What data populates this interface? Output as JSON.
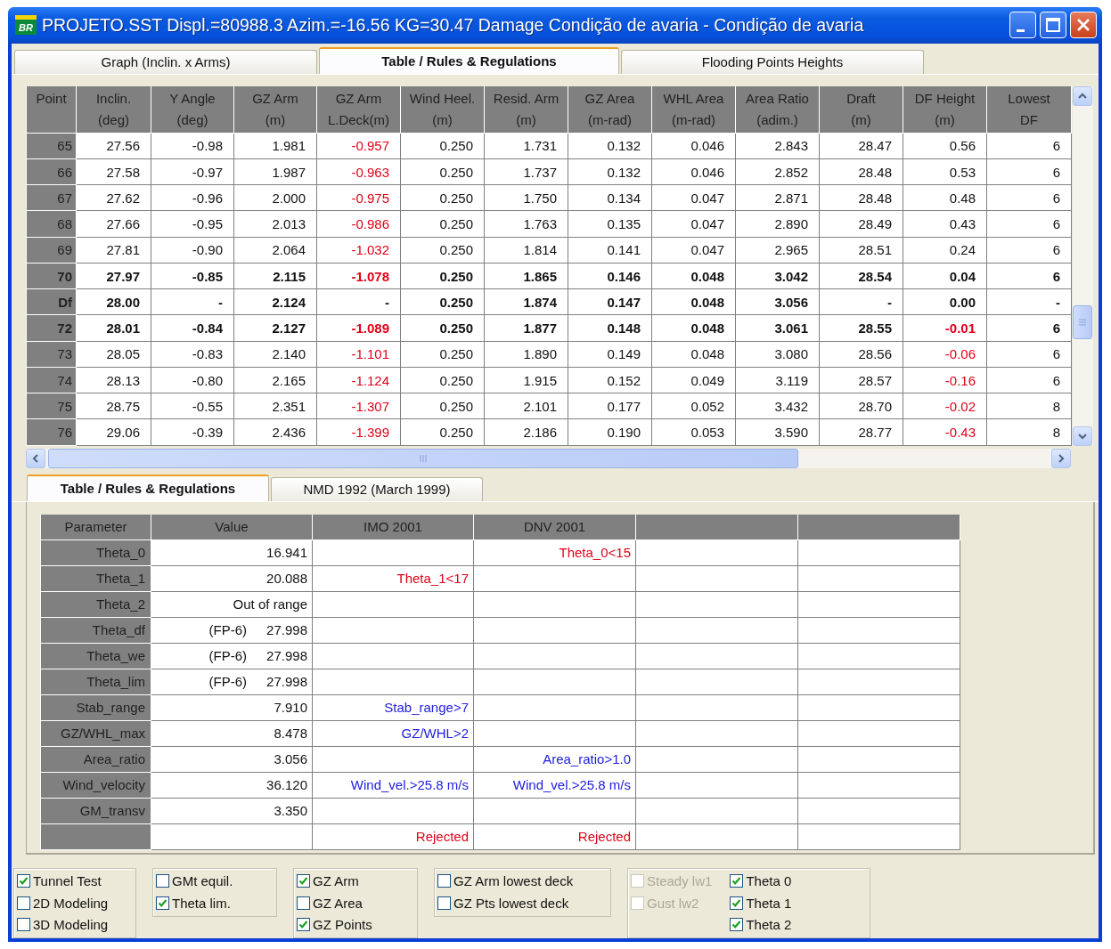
{
  "window": {
    "icon_text": "BR",
    "title": "PROJETO.SST Displ.=80988.3 Azim.=-16.56 KG=30.47 Damage Condição de avaria - Condição de avaria"
  },
  "tabs": [
    {
      "label": "Graph (Inclin. x Arms)",
      "selected": false
    },
    {
      "label": "Table / Rules & Regulations",
      "selected": true
    },
    {
      "label": "Flooding Points Heights",
      "selected": false
    }
  ],
  "grid": {
    "columns": [
      "Point",
      "Inclin.\n(deg)",
      "Y Angle\n(deg)",
      "GZ Arm\n(m)",
      "GZ Arm\nL.Deck(m)",
      "Wind Heel.\n(m)",
      "Resid. Arm\n(m)",
      "GZ Area\n(m-rad)",
      "WHL Area\n(m-rad)",
      "Area Ratio\n(adim.)",
      "Draft\n(m)",
      "DF Height\n(m)",
      "Lowest\nDF"
    ],
    "rows": [
      {
        "bold": false,
        "cells": [
          {
            "text": "65",
            "alarm": false
          },
          {
            "text": "27.56",
            "alarm": false
          },
          {
            "text": "-0.98",
            "alarm": false
          },
          {
            "text": "1.981",
            "alarm": false
          },
          {
            "text": "-0.957",
            "alarm": true
          },
          {
            "text": "0.250",
            "alarm": false
          },
          {
            "text": "1.731",
            "alarm": false
          },
          {
            "text": "0.132",
            "alarm": false
          },
          {
            "text": "0.046",
            "alarm": false
          },
          {
            "text": "2.843",
            "alarm": false
          },
          {
            "text": "28.47",
            "alarm": false
          },
          {
            "text": "0.56",
            "alarm": false
          },
          {
            "text": "6",
            "alarm": false
          }
        ]
      },
      {
        "bold": false,
        "cells": [
          {
            "text": "66",
            "alarm": false
          },
          {
            "text": "27.58",
            "alarm": false
          },
          {
            "text": "-0.97",
            "alarm": false
          },
          {
            "text": "1.987",
            "alarm": false
          },
          {
            "text": "-0.963",
            "alarm": true
          },
          {
            "text": "0.250",
            "alarm": false
          },
          {
            "text": "1.737",
            "alarm": false
          },
          {
            "text": "0.132",
            "alarm": false
          },
          {
            "text": "0.046",
            "alarm": false
          },
          {
            "text": "2.852",
            "alarm": false
          },
          {
            "text": "28.48",
            "alarm": false
          },
          {
            "text": "0.53",
            "alarm": false
          },
          {
            "text": "6",
            "alarm": false
          }
        ]
      },
      {
        "bold": false,
        "cells": [
          {
            "text": "67",
            "alarm": false
          },
          {
            "text": "27.62",
            "alarm": false
          },
          {
            "text": "-0.96",
            "alarm": false
          },
          {
            "text": "2.000",
            "alarm": false
          },
          {
            "text": "-0.975",
            "alarm": true
          },
          {
            "text": "0.250",
            "alarm": false
          },
          {
            "text": "1.750",
            "alarm": false
          },
          {
            "text": "0.134",
            "alarm": false
          },
          {
            "text": "0.047",
            "alarm": false
          },
          {
            "text": "2.871",
            "alarm": false
          },
          {
            "text": "28.48",
            "alarm": false
          },
          {
            "text": "0.48",
            "alarm": false
          },
          {
            "text": "6",
            "alarm": false
          }
        ]
      },
      {
        "bold": false,
        "cells": [
          {
            "text": "68",
            "alarm": false
          },
          {
            "text": "27.66",
            "alarm": false
          },
          {
            "text": "-0.95",
            "alarm": false
          },
          {
            "text": "2.013",
            "alarm": false
          },
          {
            "text": "-0.986",
            "alarm": true
          },
          {
            "text": "0.250",
            "alarm": false
          },
          {
            "text": "1.763",
            "alarm": false
          },
          {
            "text": "0.135",
            "alarm": false
          },
          {
            "text": "0.047",
            "alarm": false
          },
          {
            "text": "2.890",
            "alarm": false
          },
          {
            "text": "28.49",
            "alarm": false
          },
          {
            "text": "0.43",
            "alarm": false
          },
          {
            "text": "6",
            "alarm": false
          }
        ]
      },
      {
        "bold": false,
        "cells": [
          {
            "text": "69",
            "alarm": false
          },
          {
            "text": "27.81",
            "alarm": false
          },
          {
            "text": "-0.90",
            "alarm": false
          },
          {
            "text": "2.064",
            "alarm": false
          },
          {
            "text": "-1.032",
            "alarm": true
          },
          {
            "text": "0.250",
            "alarm": false
          },
          {
            "text": "1.814",
            "alarm": false
          },
          {
            "text": "0.141",
            "alarm": false
          },
          {
            "text": "0.047",
            "alarm": false
          },
          {
            "text": "2.965",
            "alarm": false
          },
          {
            "text": "28.51",
            "alarm": false
          },
          {
            "text": "0.24",
            "alarm": false
          },
          {
            "text": "6",
            "alarm": false
          }
        ]
      },
      {
        "bold": true,
        "cells": [
          {
            "text": "70",
            "alarm": false
          },
          {
            "text": "27.97",
            "alarm": false
          },
          {
            "text": "-0.85",
            "alarm": false
          },
          {
            "text": "2.115",
            "alarm": false
          },
          {
            "text": "-1.078",
            "alarm": true
          },
          {
            "text": "0.250",
            "alarm": false
          },
          {
            "text": "1.865",
            "alarm": false
          },
          {
            "text": "0.146",
            "alarm": false
          },
          {
            "text": "0.048",
            "alarm": false
          },
          {
            "text": "3.042",
            "alarm": false
          },
          {
            "text": "28.54",
            "alarm": false
          },
          {
            "text": "0.04",
            "alarm": false
          },
          {
            "text": "6",
            "alarm": false
          }
        ]
      },
      {
        "bold": true,
        "cells": [
          {
            "text": "Df",
            "alarm": false
          },
          {
            "text": "28.00",
            "alarm": false
          },
          {
            "text": "-",
            "alarm": false
          },
          {
            "text": "2.124",
            "alarm": false
          },
          {
            "text": "-",
            "alarm": false
          },
          {
            "text": "0.250",
            "alarm": false
          },
          {
            "text": "1.874",
            "alarm": false
          },
          {
            "text": "0.147",
            "alarm": false
          },
          {
            "text": "0.048",
            "alarm": false
          },
          {
            "text": "3.056",
            "alarm": false
          },
          {
            "text": "-",
            "alarm": false
          },
          {
            "text": "0.00",
            "alarm": false
          },
          {
            "text": "-",
            "alarm": false
          }
        ]
      },
      {
        "bold": true,
        "cells": [
          {
            "text": "72",
            "alarm": false
          },
          {
            "text": "28.01",
            "alarm": false
          },
          {
            "text": "-0.84",
            "alarm": false
          },
          {
            "text": "2.127",
            "alarm": false
          },
          {
            "text": "-1.089",
            "alarm": true
          },
          {
            "text": "0.250",
            "alarm": false
          },
          {
            "text": "1.877",
            "alarm": false
          },
          {
            "text": "0.148",
            "alarm": false
          },
          {
            "text": "0.048",
            "alarm": false
          },
          {
            "text": "3.061",
            "alarm": false
          },
          {
            "text": "28.55",
            "alarm": false
          },
          {
            "text": "-0.01",
            "alarm": true
          },
          {
            "text": "6",
            "alarm": false
          }
        ]
      },
      {
        "bold": false,
        "cells": [
          {
            "text": "73",
            "alarm": false
          },
          {
            "text": "28.05",
            "alarm": false
          },
          {
            "text": "-0.83",
            "alarm": false
          },
          {
            "text": "2.140",
            "alarm": false
          },
          {
            "text": "-1.101",
            "alarm": true
          },
          {
            "text": "0.250",
            "alarm": false
          },
          {
            "text": "1.890",
            "alarm": false
          },
          {
            "text": "0.149",
            "alarm": false
          },
          {
            "text": "0.048",
            "alarm": false
          },
          {
            "text": "3.080",
            "alarm": false
          },
          {
            "text": "28.56",
            "alarm": false
          },
          {
            "text": "-0.06",
            "alarm": true
          },
          {
            "text": "6",
            "alarm": false
          }
        ]
      },
      {
        "bold": false,
        "cells": [
          {
            "text": "74",
            "alarm": false
          },
          {
            "text": "28.13",
            "alarm": false
          },
          {
            "text": "-0.80",
            "alarm": false
          },
          {
            "text": "2.165",
            "alarm": false
          },
          {
            "text": "-1.124",
            "alarm": true
          },
          {
            "text": "0.250",
            "alarm": false
          },
          {
            "text": "1.915",
            "alarm": false
          },
          {
            "text": "0.152",
            "alarm": false
          },
          {
            "text": "0.049",
            "alarm": false
          },
          {
            "text": "3.119",
            "alarm": false
          },
          {
            "text": "28.57",
            "alarm": false
          },
          {
            "text": "-0.16",
            "alarm": true
          },
          {
            "text": "6",
            "alarm": false
          }
        ]
      },
      {
        "bold": false,
        "cells": [
          {
            "text": "75",
            "alarm": false
          },
          {
            "text": "28.75",
            "alarm": false
          },
          {
            "text": "-0.55",
            "alarm": false
          },
          {
            "text": "2.351",
            "alarm": false
          },
          {
            "text": "-1.307",
            "alarm": true
          },
          {
            "text": "0.250",
            "alarm": false
          },
          {
            "text": "2.101",
            "alarm": false
          },
          {
            "text": "0.177",
            "alarm": false
          },
          {
            "text": "0.052",
            "alarm": false
          },
          {
            "text": "3.432",
            "alarm": false
          },
          {
            "text": "28.70",
            "alarm": false
          },
          {
            "text": "-0.02",
            "alarm": true
          },
          {
            "text": "8",
            "alarm": false
          }
        ]
      },
      {
        "bold": false,
        "cells": [
          {
            "text": "76",
            "alarm": false
          },
          {
            "text": "29.06",
            "alarm": false
          },
          {
            "text": "-0.39",
            "alarm": false
          },
          {
            "text": "2.436",
            "alarm": false
          },
          {
            "text": "-1.399",
            "alarm": true
          },
          {
            "text": "0.250",
            "alarm": false
          },
          {
            "text": "2.186",
            "alarm": false
          },
          {
            "text": "0.190",
            "alarm": false
          },
          {
            "text": "0.053",
            "alarm": false
          },
          {
            "text": "3.590",
            "alarm": false
          },
          {
            "text": "28.77",
            "alarm": false
          },
          {
            "text": "-0.43",
            "alarm": true
          },
          {
            "text": "8",
            "alarm": false
          }
        ]
      }
    ]
  },
  "subtabs": [
    {
      "label": "Table / Rules & Regulations",
      "selected": true
    },
    {
      "label": "NMD 1992 (March 1999)",
      "selected": false
    }
  ],
  "rules": {
    "columns": [
      "Parameter",
      "Value",
      "IMO 2001",
      "DNV 2001"
    ],
    "rows": [
      {
        "parameter": "Theta_0",
        "value": "16.941",
        "dnv": {
          "text": "Theta_0<15",
          "kind": "fail"
        }
      },
      {
        "parameter": "Theta_1",
        "value": "20.088",
        "imo": {
          "text": "Theta_1<17",
          "kind": "fail"
        }
      },
      {
        "parameter": "Theta_2",
        "value": "Out of range"
      },
      {
        "parameter": "Theta_df",
        "note": "(FP-6)",
        "value": "27.998"
      },
      {
        "parameter": "Theta_we",
        "note": "(FP-6)",
        "value": "27.998"
      },
      {
        "parameter": "Theta_lim",
        "note": "(FP-6)",
        "value": "27.998"
      },
      {
        "parameter": "Stab_range",
        "value": "7.910",
        "imo": {
          "text": "Stab_range>7",
          "kind": "pass"
        }
      },
      {
        "parameter": "GZ/WHL_max",
        "value": "8.478",
        "imo": {
          "text": "GZ/WHL>2",
          "kind": "pass"
        }
      },
      {
        "parameter": "Area_ratio",
        "value": "3.056",
        "dnv": {
          "text": "Area_ratio>1.0",
          "kind": "pass"
        }
      },
      {
        "parameter": "Wind_velocity",
        "value": "36.120",
        "imo": {
          "text": "Wind_vel.>25.8 m/s",
          "kind": "pass"
        },
        "dnv": {
          "text": "Wind_vel.>25.8 m/s",
          "kind": "pass"
        }
      },
      {
        "parameter": "GM_transv",
        "value": "3.350"
      },
      {
        "imo": {
          "text": "Rejected",
          "kind": "fail"
        },
        "dnv": {
          "text": "Rejected",
          "kind": "fail"
        }
      }
    ]
  },
  "options": [
    {
      "columns": [
        [
          {
            "label": "Tunnel Test",
            "checked": true,
            "disabled": false
          },
          {
            "label": "2D Modeling",
            "checked": false,
            "disabled": false
          },
          {
            "label": "3D Modeling",
            "checked": false,
            "disabled": false
          }
        ]
      ]
    },
    {
      "columns": [
        [
          {
            "label": "GMt equil.",
            "checked": false,
            "disabled": false
          },
          {
            "label": "Theta lim.",
            "checked": true,
            "disabled": false
          }
        ]
      ]
    },
    {
      "columns": [
        [
          {
            "label": "GZ Arm",
            "checked": true,
            "disabled": false
          },
          {
            "label": "GZ Area",
            "checked": false,
            "disabled": false
          },
          {
            "label": "GZ Points",
            "checked": true,
            "disabled": false
          }
        ]
      ]
    },
    {
      "columns": [
        [
          {
            "label": "GZ Arm lowest deck",
            "checked": false,
            "disabled": false
          },
          {
            "label": "GZ Pts lowest deck",
            "checked": false,
            "disabled": false
          }
        ]
      ]
    },
    {
      "columns": [
        [
          {
            "label": "Steady lw1",
            "checked": false,
            "disabled": true
          },
          {
            "label": "Gust lw2",
            "checked": false,
            "disabled": true
          }
        ],
        [
          {
            "label": "Theta 0",
            "checked": true,
            "disabled": false
          },
          {
            "label": "Theta 1",
            "checked": true,
            "disabled": false
          },
          {
            "label": "Theta 2",
            "checked": true,
            "disabled": false
          }
        ]
      ]
    }
  ]
}
